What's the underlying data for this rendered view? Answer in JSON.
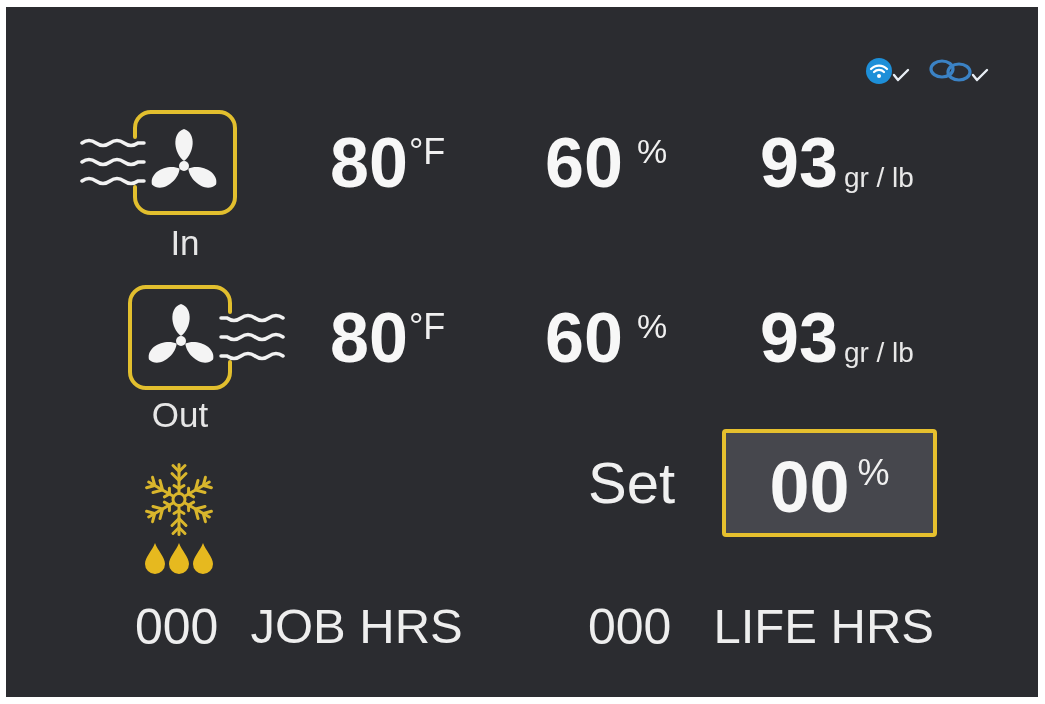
{
  "status_icons": [
    {
      "kind": "wifi"
    },
    {
      "kind": "link"
    }
  ],
  "airflows": [
    {
      "kind": "in",
      "label": "In",
      "readings": [
        {
          "kind": "temperature",
          "value": "80",
          "unit": "°F"
        },
        {
          "kind": "humidity",
          "value": "60",
          "unit": "%"
        },
        {
          "kind": "grains",
          "value": "93",
          "unit": "gr / lb"
        }
      ]
    },
    {
      "kind": "out",
      "label": "Out",
      "readings": [
        {
          "kind": "temperature",
          "value": "80",
          "unit": "°F"
        },
        {
          "kind": "humidity",
          "value": "60",
          "unit": "%"
        },
        {
          "kind": "grains",
          "value": "93",
          "unit": "gr / lb"
        }
      ]
    }
  ],
  "setpoint": {
    "label": "Set",
    "value": "00",
    "unit": "%"
  },
  "counters": [
    {
      "value": "000",
      "label": "JOB HRS"
    },
    {
      "value": "000",
      "label": "LIFE HRS"
    }
  ]
}
